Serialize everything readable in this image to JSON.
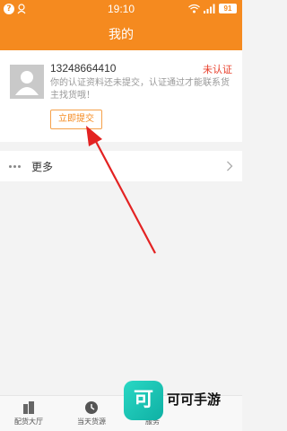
{
  "status_bar": {
    "help_glyph": "?",
    "time": "19:10",
    "battery": "91"
  },
  "header": {
    "title": "我的"
  },
  "profile": {
    "phone": "13248664410",
    "status": "未认证",
    "note": "你的认证资料还未提交，认证通过才能联系货主找货哦！",
    "submit_label": "立即提交"
  },
  "menu": {
    "more_label": "更多"
  },
  "bottom_nav": {
    "items": [
      {
        "label": "配货大厅",
        "icon": "building-icon"
      },
      {
        "label": "当天货源",
        "icon": "clock-icon"
      },
      {
        "label": "服务",
        "icon": "service-icon"
      }
    ]
  },
  "watermark": {
    "logo_glyph": "可",
    "text": "可可手游"
  },
  "colors": {
    "brand_orange": "#f58a1f",
    "alert_red": "#e8402c",
    "annotation_arrow": "#e32222"
  }
}
